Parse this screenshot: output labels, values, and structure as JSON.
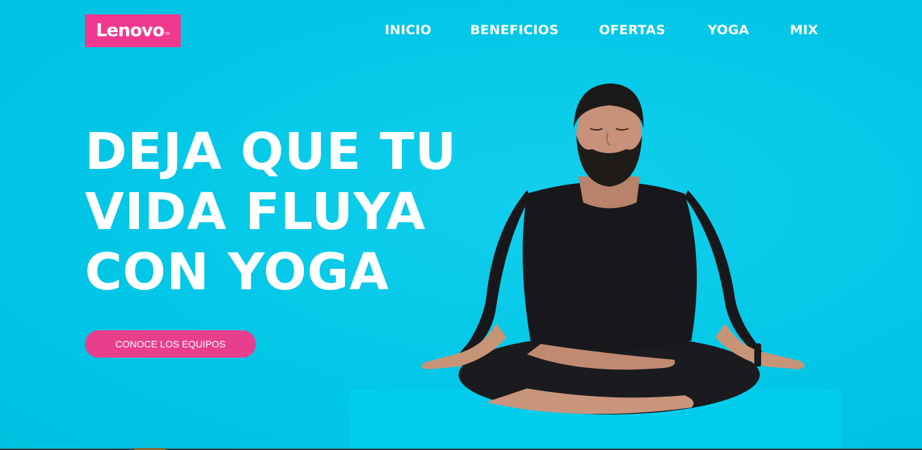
{
  "brand": {
    "logo_text": "Lenovo",
    "logo_tm": "TM",
    "logo_color": "#f0388f"
  },
  "nav": {
    "items": [
      {
        "label": "INICIO"
      },
      {
        "label": "BENEFICIOS"
      },
      {
        "label": "OFERTAS"
      },
      {
        "label": "YOGA"
      },
      {
        "label": "MIX"
      }
    ]
  },
  "hero": {
    "headline_lines": [
      "DEJA QUE TU",
      "VIDA FLUYA",
      "CON YOGA"
    ],
    "cta_label": "CONOCE LOS EQUIPOS",
    "cta_color": "#e83f8c",
    "background_color": "#00c8e8",
    "image": "man-meditating-lotus-pose"
  }
}
